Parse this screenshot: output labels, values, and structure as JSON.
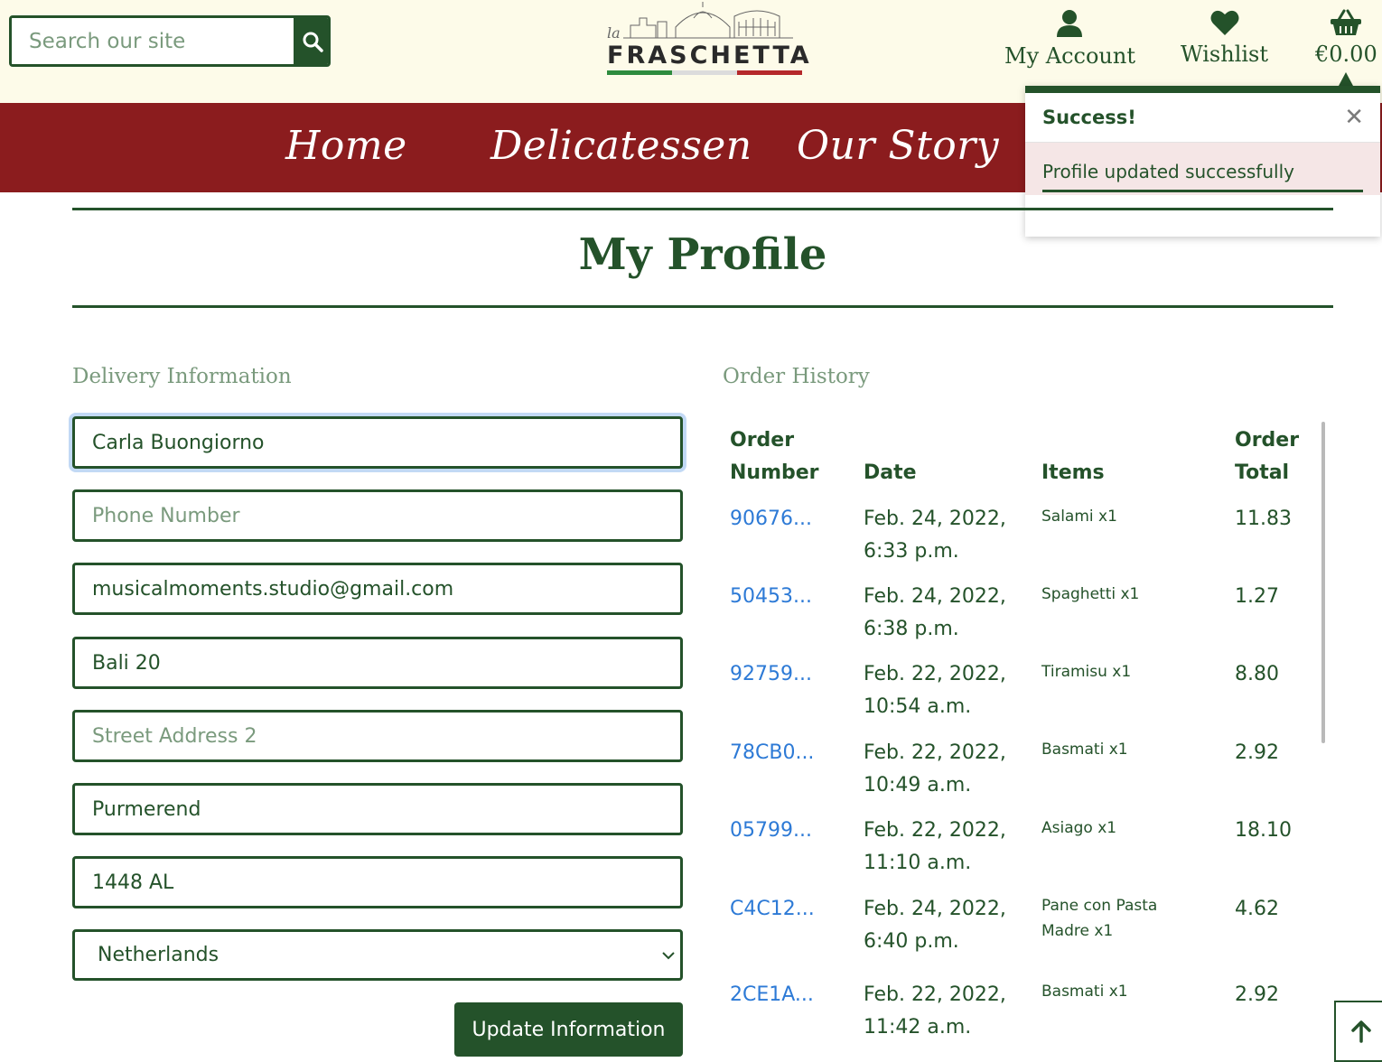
{
  "header": {
    "search_placeholder": "Search our site",
    "logo_prefix": "la",
    "logo_word": "FRASCHETTA",
    "account_label": "My Account",
    "wishlist_label": "Wishlist",
    "cart_total": "€0.00"
  },
  "nav": {
    "items": [
      "Home",
      "Delicatessen",
      "Our Story"
    ]
  },
  "toast": {
    "title": "Success!",
    "message": "Profile updated successfully",
    "close_glyph": "✕"
  },
  "page": {
    "title": "My Profile"
  },
  "delivery": {
    "heading": "Delivery Information",
    "full_name": "Carla Buongiorno",
    "phone_placeholder": "Phone Number",
    "email": "musicalmoments.studio@gmail.com",
    "street1": "Bali 20",
    "street2_placeholder": "Street Address 2",
    "town": "Purmerend",
    "postcode": "1448 AL",
    "country": "Netherlands",
    "submit_label": "Update Information"
  },
  "orders": {
    "heading": "Order History",
    "columns": {
      "number_line1": "Order",
      "number_line2": "Number",
      "date": "Date",
      "items": "Items",
      "total_line1": "Order",
      "total_line2": "Total"
    },
    "rows": [
      {
        "number": "90676...",
        "date1": "Feb. 24, 2022,",
        "date2": "6:33 p.m.",
        "items": "Salami x1",
        "total": "11.83"
      },
      {
        "number": "50453...",
        "date1": "Feb. 24, 2022,",
        "date2": "6:38 p.m.",
        "items": "Spaghetti x1",
        "total": "1.27"
      },
      {
        "number": "92759...",
        "date1": "Feb. 22, 2022,",
        "date2": "10:54 a.m.",
        "items": "Tiramisu x1",
        "total": "8.80"
      },
      {
        "number": "78CB0...",
        "date1": "Feb. 22, 2022,",
        "date2": "10:49 a.m.",
        "items": "Basmati x1",
        "total": "2.92"
      },
      {
        "number": "05799...",
        "date1": "Feb. 22, 2022,",
        "date2": "11:10 a.m.",
        "items": "Asiago x1",
        "total": "18.10"
      },
      {
        "number": "C4C12...",
        "date1": "Feb. 24, 2022,",
        "date2": "6:40 p.m.",
        "items": "Pane con Pasta Madre x1",
        "total": "4.62"
      },
      {
        "number": "2CE1A...",
        "date1": "Feb. 22, 2022,",
        "date2": "11:42 a.m.",
        "items": "Basmati x1",
        "total": "2.92"
      }
    ]
  },
  "colors": {
    "primary_green": "#24522a",
    "nav_red": "#8b1c1e",
    "header_cream": "#fdfbe9",
    "link_blue": "#2d7ad6",
    "muted_green": "#7a9a7d"
  },
  "icons": [
    "search-icon",
    "user-icon",
    "heart-icon",
    "basket-icon",
    "close-icon",
    "chevron-down-icon",
    "arrow-up-icon"
  ]
}
